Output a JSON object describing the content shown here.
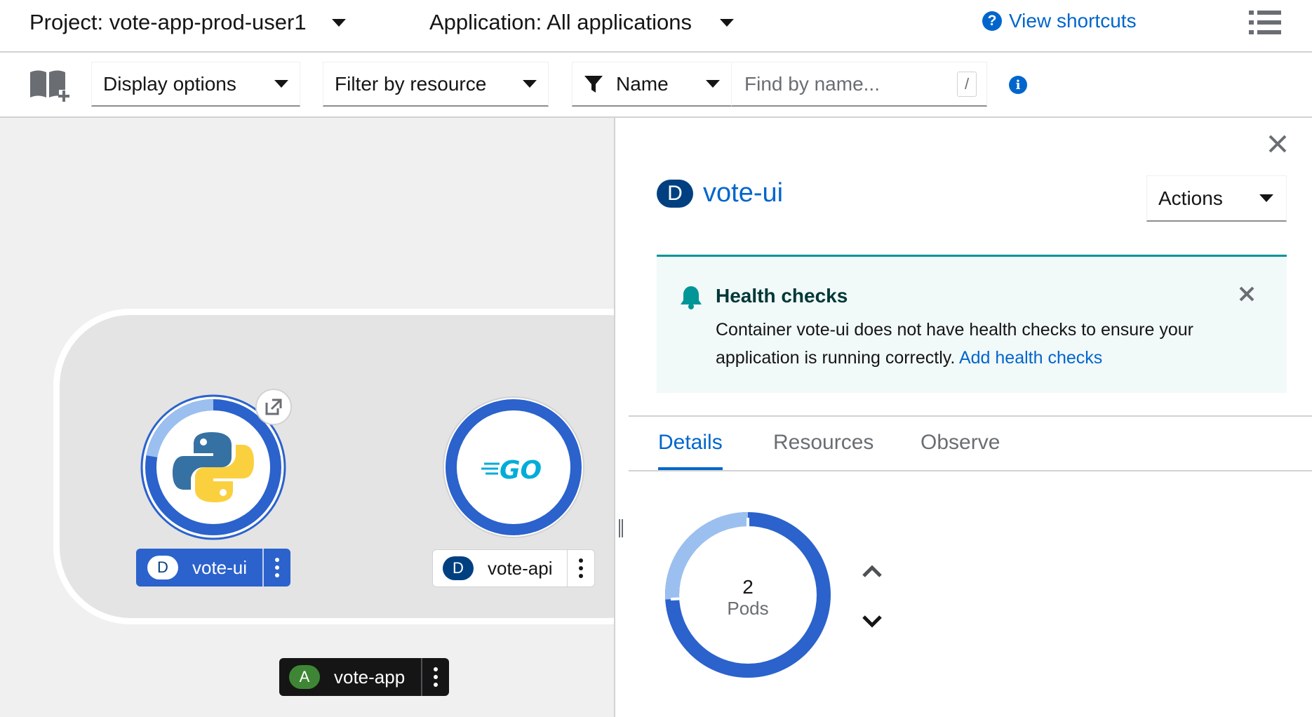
{
  "topbar": {
    "project_label": "Project: vote-app-prod-user1",
    "application_label": "Application: All applications",
    "view_shortcuts": "View shortcuts"
  },
  "toolbar": {
    "display_options": "Display options",
    "filter_by_resource": "Filter by resource",
    "filter_type": "Name",
    "search_placeholder": "Find by name...",
    "search_shortcut": "/"
  },
  "topology": {
    "nodes": [
      {
        "badge": "D",
        "name": "vote-ui",
        "runtime": "python",
        "selected": true
      },
      {
        "badge": "D",
        "name": "vote-api",
        "runtime": "go",
        "selected": false
      }
    ],
    "go_logo_text": "GO",
    "application": {
      "badge": "A",
      "name": "vote-app"
    }
  },
  "panel": {
    "badge": "D",
    "title": "vote-ui",
    "actions_label": "Actions",
    "alert": {
      "title": "Health checks",
      "body": "Container vote-ui does not have health checks to ensure your application is running correctly.",
      "link": "Add health checks"
    },
    "tabs": [
      "Details",
      "Resources",
      "Observe"
    ],
    "active_tab": "Details",
    "pods": {
      "count": "2",
      "label": "Pods"
    }
  },
  "colors": {
    "accent": "#0066cc",
    "pod_running": "#2b62cc",
    "pod_pending": "#9bc0f0",
    "badge_deployment": "#004080",
    "badge_application": "#3e8635",
    "alert_border": "#009596"
  }
}
